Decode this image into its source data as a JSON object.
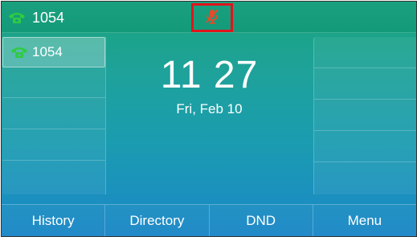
{
  "status_bar": {
    "account_label": "1054",
    "account_icon": "phone-handset-icon",
    "status_icon": "mute-icon",
    "highlight_color": "#e0141c"
  },
  "line_keys_left": [
    {
      "label": "1054",
      "icon": "phone-handset-icon",
      "active": true
    },
    {
      "label": ""
    },
    {
      "label": ""
    },
    {
      "label": ""
    },
    {
      "label": ""
    }
  ],
  "line_keys_right": [
    {
      "label": ""
    },
    {
      "label": ""
    },
    {
      "label": ""
    },
    {
      "label": ""
    },
    {
      "label": ""
    }
  ],
  "clock": {
    "time": "11 27",
    "date": "Fri, Feb 10"
  },
  "softkeys": [
    "History",
    "Directory",
    "DND",
    "Menu"
  ],
  "colors": {
    "accent_green": "#2ecc40",
    "text": "#ffffff"
  }
}
